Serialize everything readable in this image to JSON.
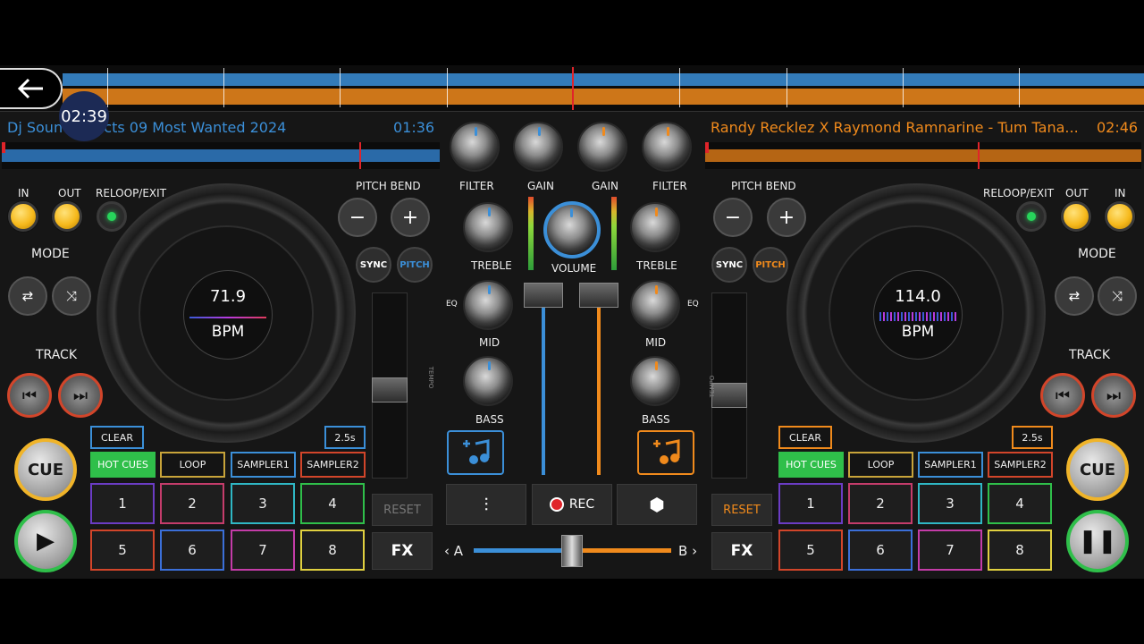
{
  "top_time_bubble": "02:39",
  "colors": {
    "deck_a": "#3b8fd8",
    "deck_b": "#f08a1c",
    "green": "#2fbf4a",
    "yellow": "#f0b429",
    "red": "#d2452a"
  },
  "deck_a": {
    "title": "Dj Sound Effects 09  Most Wanted 2024",
    "title_visible": "Dj Sou",
    "title_visible_rest": "cts 09  Most Wanted 2024",
    "time": "01:36",
    "in": "IN",
    "out": "OUT",
    "reloop": "RELOOP/EXIT",
    "pitch_bend": "PITCH BEND",
    "minus": "−",
    "plus": "+",
    "sync": "SYNC",
    "pitch": "PITCH",
    "mode": "MODE",
    "track": "TRACK",
    "bpm_value": "71.9",
    "bpm_unit": "BPM",
    "tempo_label": "TEMPO",
    "clear": "CLEAR",
    "loop_len": "2.5s",
    "tabs": [
      "HOT CUES",
      "LOOP",
      "SAMPLER1",
      "SAMPLER2"
    ],
    "pads": [
      "1",
      "2",
      "3",
      "4",
      "5",
      "6",
      "7",
      "8"
    ],
    "cue": "CUE",
    "reset": "RESET",
    "fx": "FX"
  },
  "deck_b": {
    "title": "Randy Recklez X Raymond Ramnarine - Tum Tana...",
    "time": "02:46",
    "in": "IN",
    "out": "OUT",
    "reloop": "RELOOP/EXIT",
    "pitch_bend": "PITCH BEND",
    "minus": "−",
    "plus": "+",
    "sync": "SYNC",
    "pitch": "PITCH",
    "mode": "MODE",
    "track": "TRACK",
    "bpm_value": "114.0",
    "bpm_unit": "BPM",
    "tempo_label": "TEMPO",
    "clear": "CLEAR",
    "loop_len": "2.5s",
    "tabs": [
      "HOT CUES",
      "LOOP",
      "SAMPLER1",
      "SAMPLER2"
    ],
    "pads": [
      "1",
      "2",
      "3",
      "4",
      "5",
      "6",
      "7",
      "8"
    ],
    "cue": "CUE",
    "reset": "RESET",
    "fx": "FX"
  },
  "mixer": {
    "filter_a": "FILTER",
    "gain_a": "GAIN",
    "gain_b": "GAIN",
    "filter_b": "FILTER",
    "treble_a": "TREBLE",
    "volume": "VOLUME",
    "treble_b": "TREBLE",
    "eq_a": "EQ",
    "eq_b": "EQ",
    "mid_a": "MID",
    "mid_b": "MID",
    "bass_a": "BASS",
    "bass_b": "BASS",
    "rec": "REC",
    "cross_a": "A",
    "cross_b": "B"
  }
}
